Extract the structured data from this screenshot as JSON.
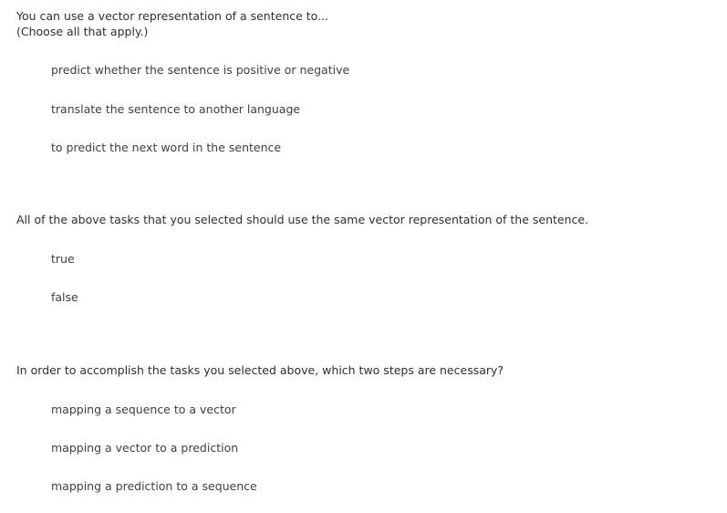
{
  "questions": [
    {
      "prompt": "You can use a vector representation of a sentence to...\n(Choose all that apply.)",
      "options": [
        "predict whether the sentence is positive or negative",
        "translate the sentence to another language",
        "to predict the next word in the sentence"
      ]
    },
    {
      "prompt": "All of the above tasks that you selected should use the same vector representation of the sentence.",
      "options": [
        "true",
        "false"
      ]
    },
    {
      "prompt": "In order to accomplish the tasks you selected above, which two steps are necessary?",
      "options": [
        "mapping a sequence to a vector",
        "mapping a vector to a prediction",
        "mapping a prediction to a sequence"
      ]
    }
  ]
}
